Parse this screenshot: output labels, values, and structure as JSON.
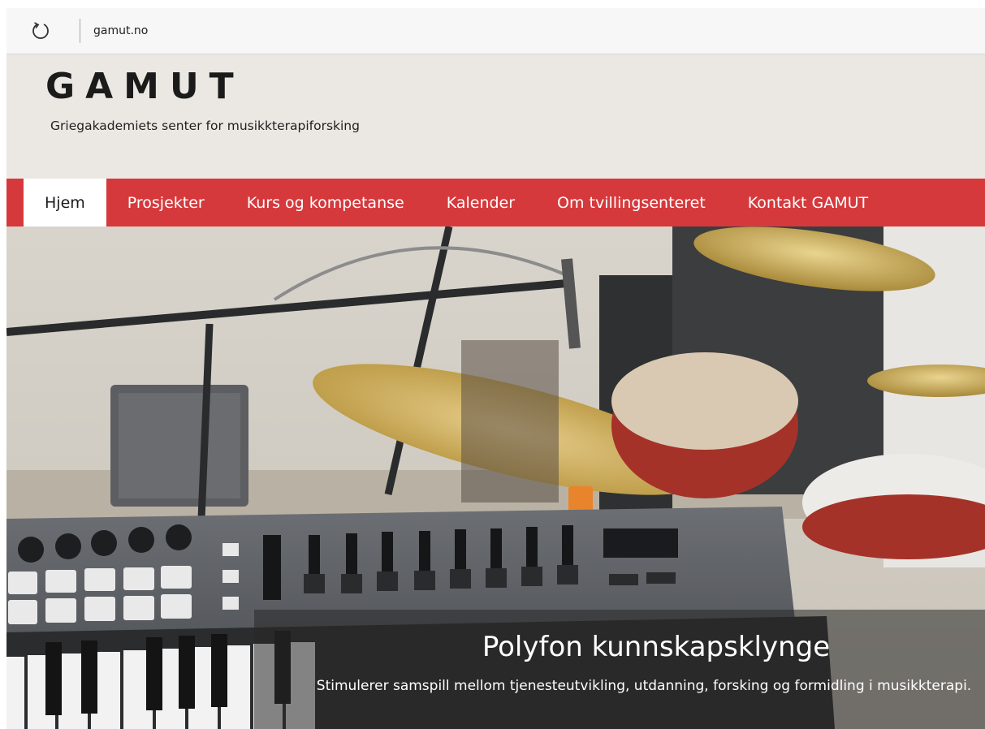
{
  "browser": {
    "url": "gamut.no",
    "reload_icon": "reload-icon"
  },
  "site": {
    "logo": "GAMUT",
    "tagline": "Griegakademiets senter for musikkterapiforsking"
  },
  "nav": {
    "items": [
      {
        "label": "Hjem",
        "active": true
      },
      {
        "label": "Prosjekter",
        "active": false
      },
      {
        "label": "Kurs og kompetanse",
        "active": false
      },
      {
        "label": "Kalender",
        "active": false
      },
      {
        "label": "Om tvillingsenteret",
        "active": false
      },
      {
        "label": "Kontakt GAMUT",
        "active": false
      }
    ]
  },
  "hero": {
    "title": "Polyfon kunnskapsklynge",
    "text": "Stimulerer samspill mellom tjenesteutvikling, utdanning, forsking og formidling i musikkterapi."
  },
  "colors": {
    "nav_bg": "#d6393c",
    "header_bg": "#ebe8e3",
    "active_tab_bg": "#ffffff"
  }
}
